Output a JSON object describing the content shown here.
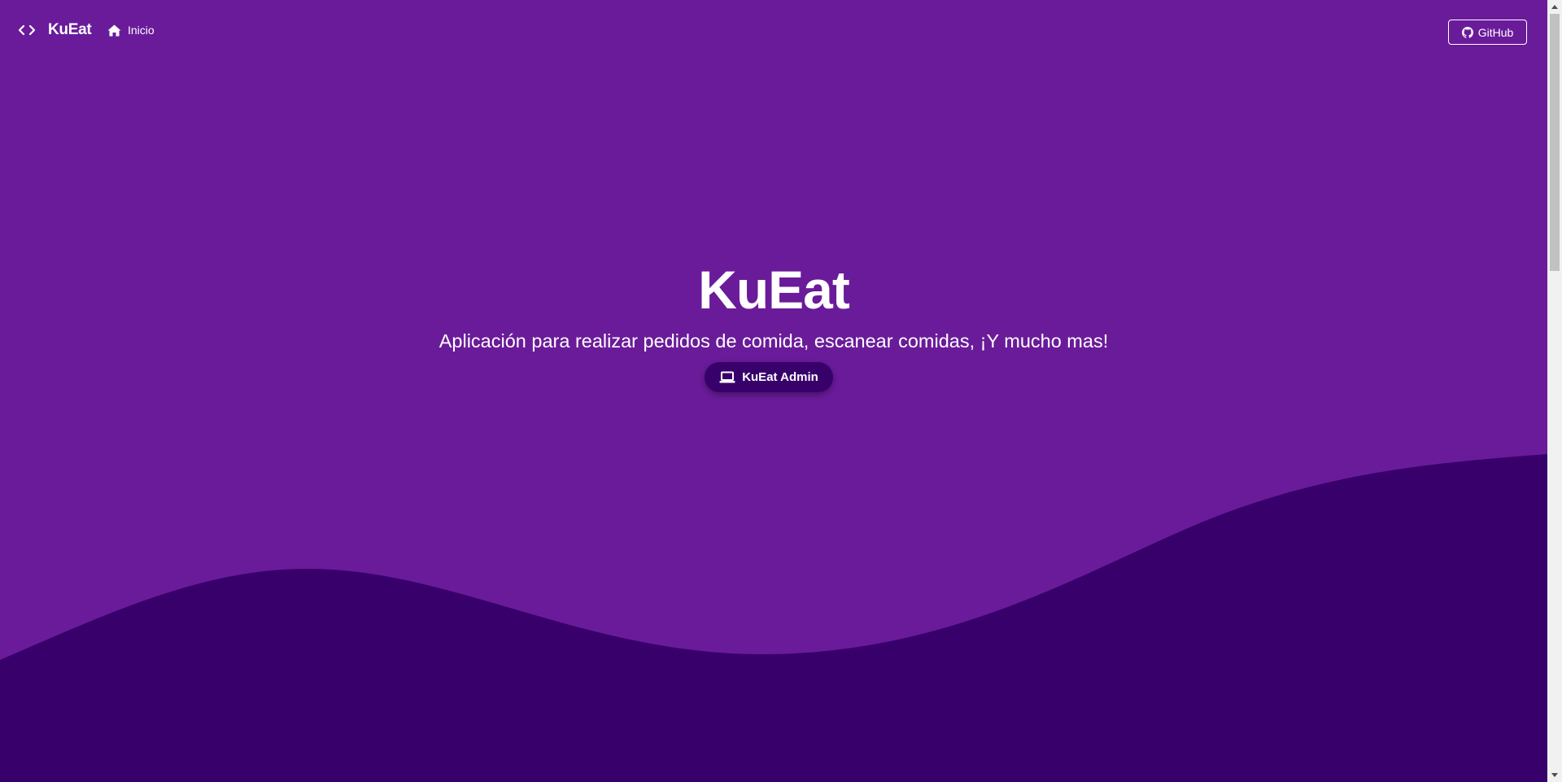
{
  "navbar": {
    "brand": "KuEat",
    "brand_icon": "code-icon",
    "home_label": "Inicio",
    "home_icon": "home-icon",
    "github_label": "GitHub",
    "github_icon": "github-icon"
  },
  "hero": {
    "title": "KuEat",
    "subtitle": "Aplicación para realizar pedidos de comida, escanear comidas, ¡Y mucho mas!",
    "admin_button_label": "KuEat Admin",
    "admin_button_icon": "laptop-icon"
  },
  "colors": {
    "background": "#6a1b9a",
    "wave": "#38006b",
    "button_bg": "#38006b",
    "text": "#ffffff"
  }
}
